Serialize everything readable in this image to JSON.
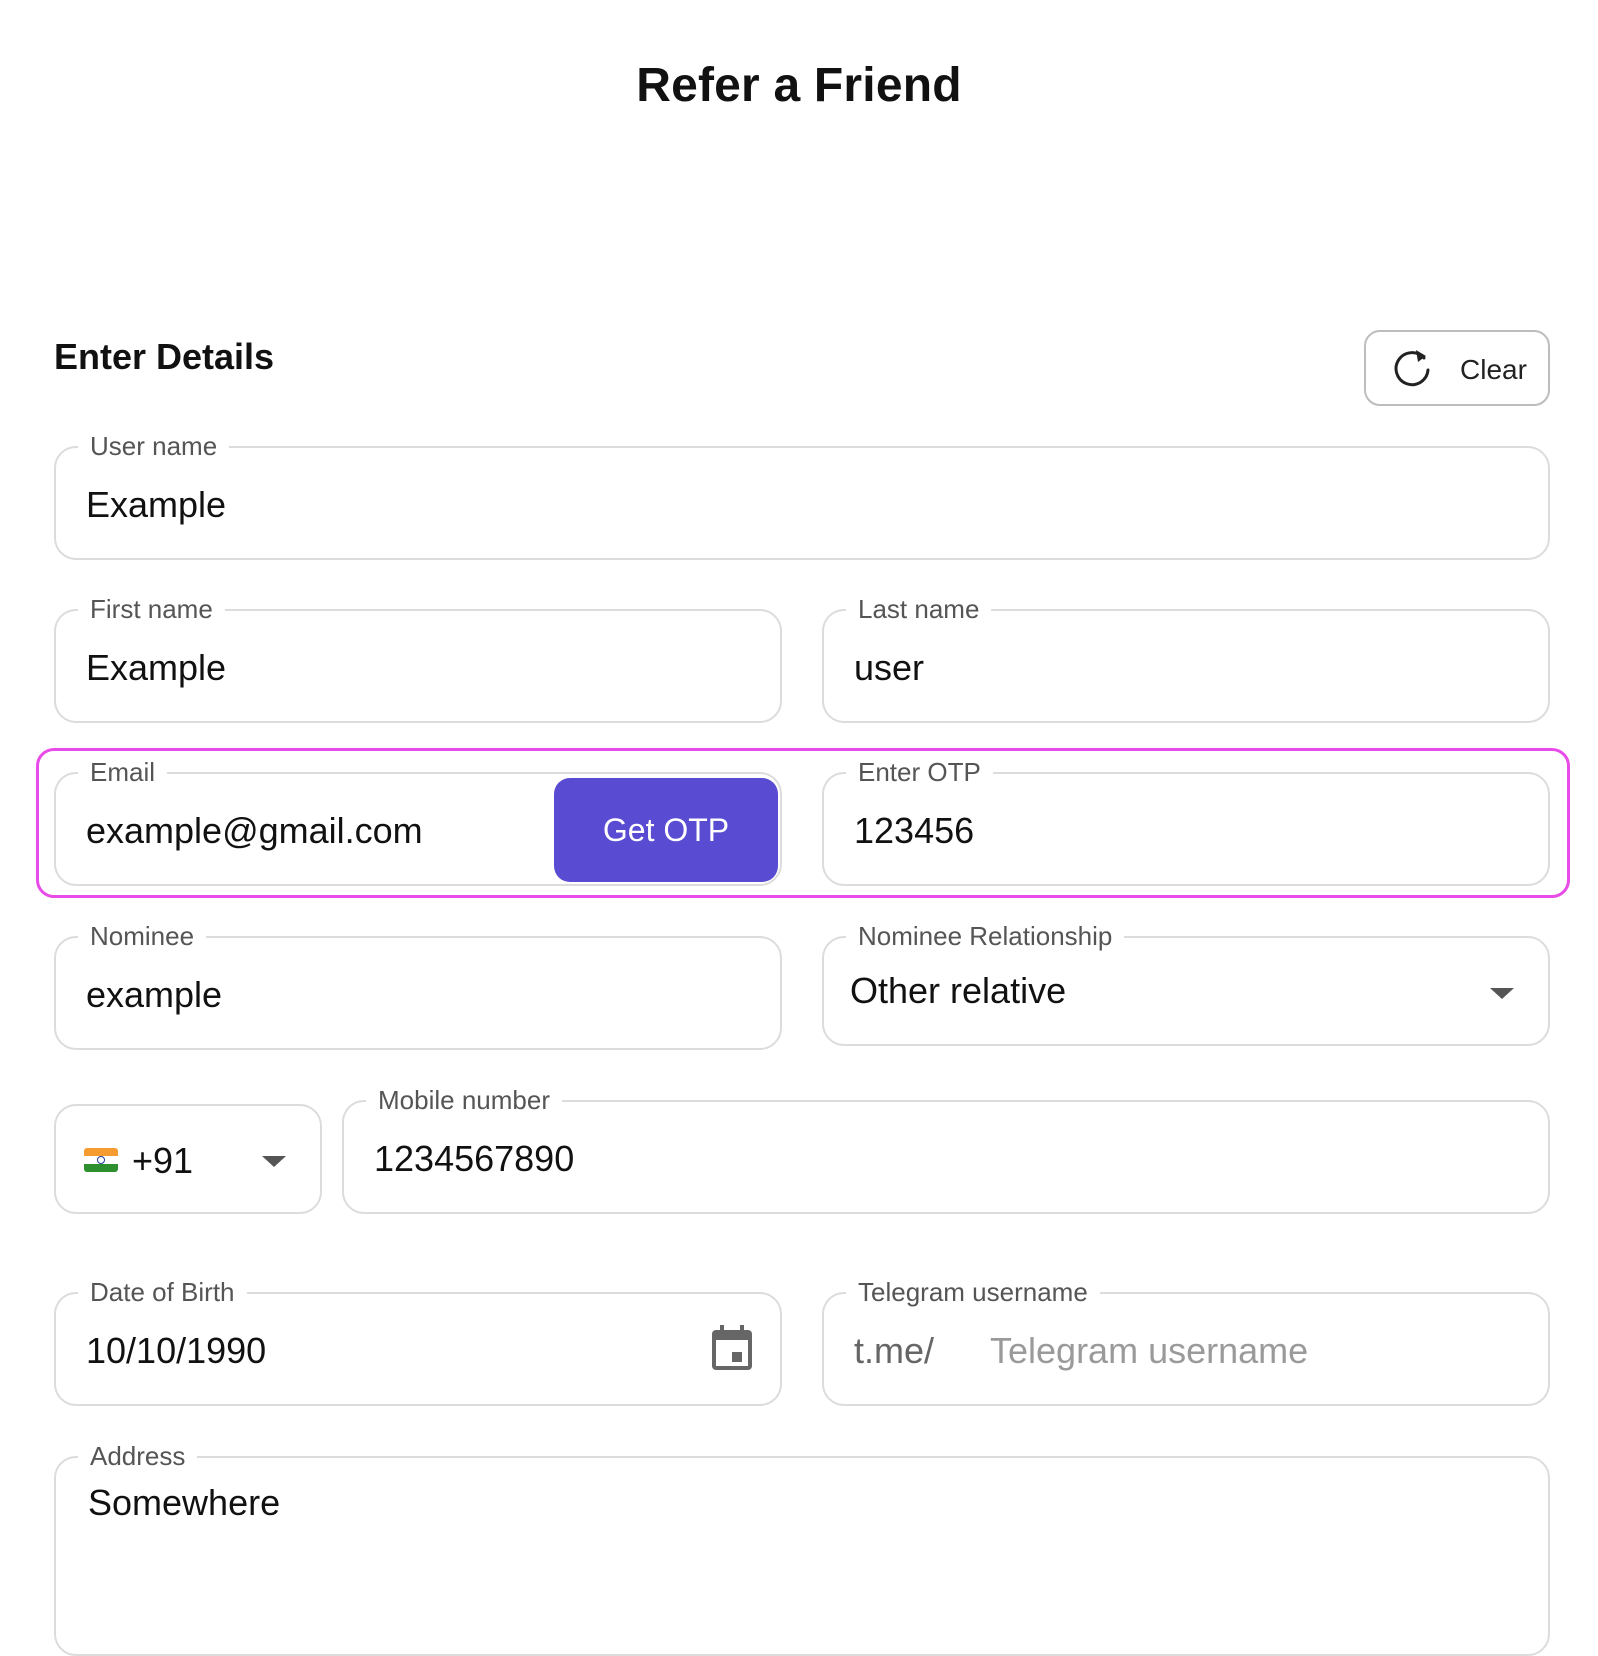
{
  "page": {
    "title": "Refer a Friend"
  },
  "section": {
    "title": "Enter Details"
  },
  "toolbar": {
    "clear_label": "Clear",
    "clear_icon": "refresh-icon"
  },
  "form": {
    "user_name": {
      "label": "User name",
      "value": "Example"
    },
    "first_name": {
      "label": "First name",
      "value": "Example"
    },
    "last_name": {
      "label": "Last name",
      "value": "user"
    },
    "email": {
      "label": "Email",
      "value": "example@gmail.com",
      "otp_button": "Get OTP"
    },
    "otp": {
      "label": "Enter OTP",
      "value": "123456"
    },
    "nominee": {
      "label": "Nominee",
      "value": "example"
    },
    "nominee_relationship": {
      "label": "Nominee Relationship",
      "value": "Other relative"
    },
    "country_code": {
      "value": "+91",
      "flag": "india-flag-icon"
    },
    "mobile": {
      "label": "Mobile number",
      "value": "1234567890"
    },
    "dob": {
      "label": "Date of Birth",
      "value": "10/10/1990",
      "icon": "calendar-icon"
    },
    "telegram": {
      "label": "Telegram username",
      "prefix": "t.me/",
      "placeholder": "Telegram username"
    },
    "address": {
      "label": "Address",
      "value": "Somewhere"
    }
  },
  "colors": {
    "accent": "#5a4bd3",
    "highlight": "#e84be8",
    "border": "#dcdcdc",
    "label": "#555555",
    "placeholder": "#9a9a9a"
  }
}
